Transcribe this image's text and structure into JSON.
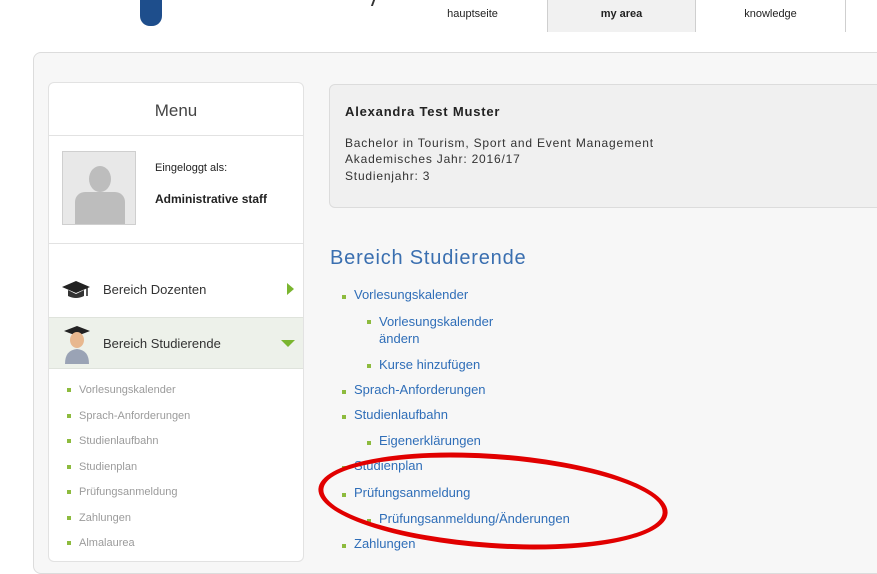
{
  "top_tabs": [
    {
      "label": "hauptseite"
    },
    {
      "label": "my area"
    },
    {
      "label": "knowledge"
    }
  ],
  "sidebar": {
    "title": "Menu",
    "login_label": "Eingeloggt als:",
    "login_role": "Administrative staff",
    "items": [
      {
        "label": "Bereich Dozenten",
        "icon": "graduation-cap-icon",
        "expanded": false
      },
      {
        "label": "Bereich Studierende",
        "icon": "student-avatar-icon",
        "expanded": true
      }
    ],
    "sub_items": [
      {
        "label": "Vorlesungskalender"
      },
      {
        "label": "Sprach-Anforderungen"
      },
      {
        "label": "Studienlaufbahn"
      },
      {
        "label": "Studienplan"
      },
      {
        "label": "Prüfungsanmeldung"
      },
      {
        "label": "Zahlungen"
      },
      {
        "label": "Almalaurea"
      }
    ]
  },
  "info": {
    "name": "Alexandra Test Muster",
    "program": "Bachelor in Tourism, Sport and Event Management",
    "academic_year": "Akademisches Jahr: 2016/17",
    "study_year": "Studienjahr: 3"
  },
  "section": {
    "title": "Bereich Studierende",
    "links": [
      {
        "label": "Vorlesungskalender"
      },
      {
        "label": "Vorlesungskalender ändern"
      },
      {
        "label": "Kurse hinzufügen"
      },
      {
        "label": "Sprach-Anforderungen"
      },
      {
        "label": "Studienlaufbahn"
      },
      {
        "label": "Eigenerklärungen"
      },
      {
        "label": "Studienplan"
      },
      {
        "label": "Prüfungsanmeldung"
      },
      {
        "label": "Prüfungsanmeldung/Änderungen"
      },
      {
        "label": "Zahlungen"
      }
    ]
  },
  "colors": {
    "link": "#2f6eb8",
    "bullet": "#8dbb3e",
    "highlight_ellipse": "#e10000"
  }
}
